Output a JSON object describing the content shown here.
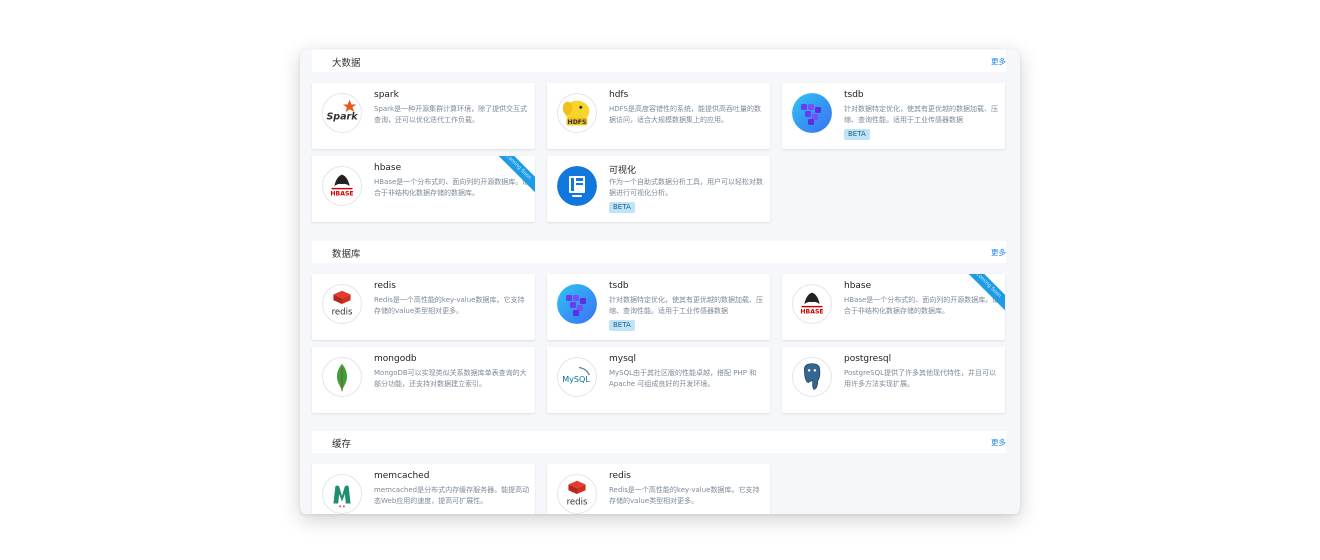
{
  "colors": {
    "accent": "#1e88e5",
    "badge_bg": "#bfe4f8",
    "ribbon": "#1e9be6",
    "panel_bg": "#f5f7fa"
  },
  "sections": [
    {
      "title": "大数据",
      "more": "更多",
      "cards": [
        {
          "name": "spark",
          "desc": "Spark是一种开源集群计算环境，除了提供交互式查询，还可以优化迭代工作负载。",
          "icon": "spark-icon"
        },
        {
          "name": "hdfs",
          "desc": "HDFS是高度容错性的系统，能提供高吞吐量的数据访问，适合大规模数据集上的应用。",
          "icon": "hdfs-icon"
        },
        {
          "name": "tsdb",
          "desc": "针对数据特定优化，使其有更优越的数据加载、压缩、查询性能。适用于工业传感器数据",
          "badge": "BETA",
          "icon": "tsdb-icon"
        },
        {
          "name": "hbase",
          "desc": "HBase是一个分布式的、面向列的开源数据库。适合于非结构化数据存储的数据库。",
          "ribbon": "Coming Soon",
          "icon": "hbase-icon"
        },
        {
          "name": "可视化",
          "desc": "作为一个自助式数据分析工具，用户可以轻松对数据进行可视化分析。",
          "badge": "BETA",
          "icon": "visualization-icon"
        }
      ]
    },
    {
      "title": "数据库",
      "more": "更多",
      "cards": [
        {
          "name": "redis",
          "desc": "Redis是一个高性能的key-value数据库。它支持存储的value类型相对更多。",
          "icon": "redis-icon"
        },
        {
          "name": "tsdb",
          "desc": "针对数据特定优化，使其有更优越的数据加载、压缩、查询性能。适用于工业传感器数据",
          "badge": "BETA",
          "icon": "tsdb-icon"
        },
        {
          "name": "hbase",
          "desc": "HBase是一个分布式的、面向列的开源数据库。适合于非结构化数据存储的数据库。",
          "ribbon": "Coming Soon",
          "icon": "hbase-icon"
        },
        {
          "name": "mongodb",
          "desc": "MongoDB可以实现类似关系数据库单表查询的大部分功能，还支持对数据建立索引。",
          "icon": "mongodb-icon"
        },
        {
          "name": "mysql",
          "desc": "MySQL由于其社区版的性能卓越，搭配 PHP 和 Apache 可组成良好的开发环境。",
          "icon": "mysql-icon"
        },
        {
          "name": "postgresql",
          "desc": "PostgreSQL提供了许多其他现代特性，并且可以用许多方法实现扩展。",
          "icon": "postgresql-icon"
        }
      ]
    },
    {
      "title": "缓存",
      "more": "更多",
      "cards": [
        {
          "name": "memcached",
          "desc": "memcached是分布式内存缓存服务器。能提高动态Web应用的速度，提高可扩展性。",
          "icon": "memcached-icon"
        },
        {
          "name": "redis",
          "desc": "Redis是一个高性能的key-value数据库。它支持存储的value类型相对更多。",
          "icon": "redis-icon"
        }
      ]
    }
  ],
  "logo_text": {
    "spark": "Spark",
    "hdfs": "HDFS",
    "hbase": "HBASE",
    "redis": "redis",
    "mysql": "MySQL"
  }
}
